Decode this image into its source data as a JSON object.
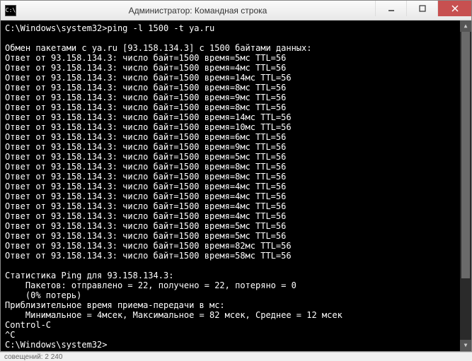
{
  "titlebar": {
    "icon_text": "C:\\",
    "title": "Администратор: Командная строка"
  },
  "prompt1": "C:\\Windows\\system32>ping -l 1500 -t ya.ru",
  "header": "Обмен пакетами с ya.ru [93.158.134.3] с 1500 байтами данных:",
  "replies": [
    "Ответ от 93.158.134.3: число байт=1500 время=5мс TTL=56",
    "Ответ от 93.158.134.3: число байт=1500 время=4мс TTL=56",
    "Ответ от 93.158.134.3: число байт=1500 время=14мс TTL=56",
    "Ответ от 93.158.134.3: число байт=1500 время=8мс TTL=56",
    "Ответ от 93.158.134.3: число байт=1500 время=9мс TTL=56",
    "Ответ от 93.158.134.3: число байт=1500 время=8мс TTL=56",
    "Ответ от 93.158.134.3: число байт=1500 время=14мс TTL=56",
    "Ответ от 93.158.134.3: число байт=1500 время=10мс TTL=56",
    "Ответ от 93.158.134.3: число байт=1500 время=6мс TTL=56",
    "Ответ от 93.158.134.3: число байт=1500 время=9мс TTL=56",
    "Ответ от 93.158.134.3: число байт=1500 время=5мс TTL=56",
    "Ответ от 93.158.134.3: число байт=1500 время=8мс TTL=56",
    "Ответ от 93.158.134.3: число байт=1500 время=8мс TTL=56",
    "Ответ от 93.158.134.3: число байт=1500 время=4мс TTL=56",
    "Ответ от 93.158.134.3: число байт=1500 время=4мс TTL=56",
    "Ответ от 93.158.134.3: число байт=1500 время=4мс TTL=56",
    "Ответ от 93.158.134.3: число байт=1500 время=4мс TTL=56",
    "Ответ от 93.158.134.3: число байт=1500 время=5мс TTL=56",
    "Ответ от 93.158.134.3: число байт=1500 время=5мс TTL=56",
    "Ответ от 93.158.134.3: число байт=1500 время=82мс TTL=56",
    "Ответ от 93.158.134.3: число байт=1500 время=58мс TTL=56"
  ],
  "stats": {
    "blank": " ",
    "stat_header": "Статистика Ping для 93.158.134.3:",
    "packets": "    Пакетов: отправлено = 22, получено = 22, потеряно = 0",
    "loss": "    (0% потерь)",
    "rtt_header": "Приблизительное время приема-передачи в мс:",
    "rtt": "    Минимальное = 4мсек, Максимальное = 82 мсек, Среднее = 12 мсек"
  },
  "ctrl_c": "Control-C",
  "caret": "^C",
  "prompt2": "C:\\Windows\\system32>",
  "bottom": "совещений:   2 240"
}
